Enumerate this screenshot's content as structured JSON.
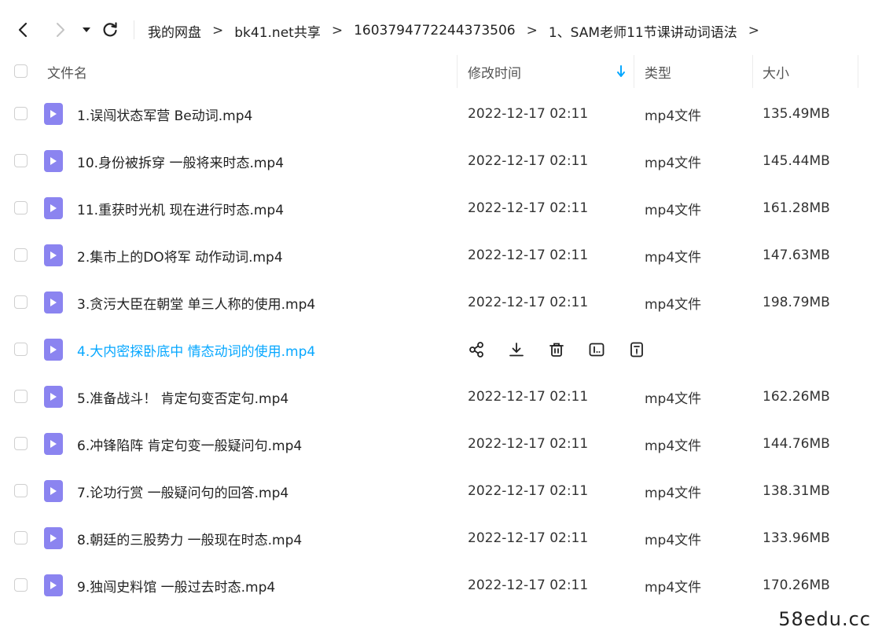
{
  "breadcrumb": [
    "我的网盘",
    "bk41.net共享",
    "1603794772244373506",
    "1、SAM老师11节课讲动词语法"
  ],
  "breadcrumb_separator": ">",
  "columns": {
    "name": "文件名",
    "modified": "修改时间",
    "type": "类型",
    "size": "大小"
  },
  "accent_color": "#06a7ff",
  "file_icon_color": "#8b84f0",
  "files": [
    {
      "name": "1.误闯状态军营   Be动词.mp4",
      "modified": "2022-12-17 02:11",
      "type": "mp4文件",
      "size": "135.49MB"
    },
    {
      "name": "10.身份被拆穿    一般将来时态.mp4",
      "modified": "2022-12-17 02:11",
      "type": "mp4文件",
      "size": "145.44MB"
    },
    {
      "name": "11.重获时光机    现在进行时态.mp4",
      "modified": "2022-12-17 02:11",
      "type": "mp4文件",
      "size": "161.28MB"
    },
    {
      "name": "2.集市上的DO将军    动作动词.mp4",
      "modified": "2022-12-17 02:11",
      "type": "mp4文件",
      "size": "147.63MB"
    },
    {
      "name": "3.贪污大臣在朝堂    单三人称的使用.mp4",
      "modified": "2022-12-17 02:11",
      "type": "mp4文件",
      "size": "198.79MB"
    },
    {
      "name": "4.大内密探卧底中    情态动词的使用.mp4",
      "modified": "",
      "type": "",
      "size": "",
      "hover": true
    },
    {
      "name": "5.准备战斗！    肯定句变否定句.mp4",
      "modified": "2022-12-17 02:11",
      "type": "mp4文件",
      "size": "162.26MB"
    },
    {
      "name": "6.冲锋陷阵    肯定句变一般疑问句.mp4",
      "modified": "2022-12-17 02:11",
      "type": "mp4文件",
      "size": "144.76MB"
    },
    {
      "name": "7.论功行赏    一般疑问句的回答.mp4",
      "modified": "2022-12-17 02:11",
      "type": "mp4文件",
      "size": "138.31MB"
    },
    {
      "name": "8.朝廷的三股势力    一般现在时态.mp4",
      "modified": "2022-12-17 02:11",
      "type": "mp4文件",
      "size": "133.96MB"
    },
    {
      "name": "9.独闯史料馆    一般过去时态.mp4",
      "modified": "2022-12-17 02:11",
      "type": "mp4文件",
      "size": "170.26MB"
    }
  ],
  "row_actions": [
    "share-icon",
    "download-icon",
    "delete-icon",
    "rename-icon",
    "details-icon"
  ],
  "watermark": "58edu.cc"
}
